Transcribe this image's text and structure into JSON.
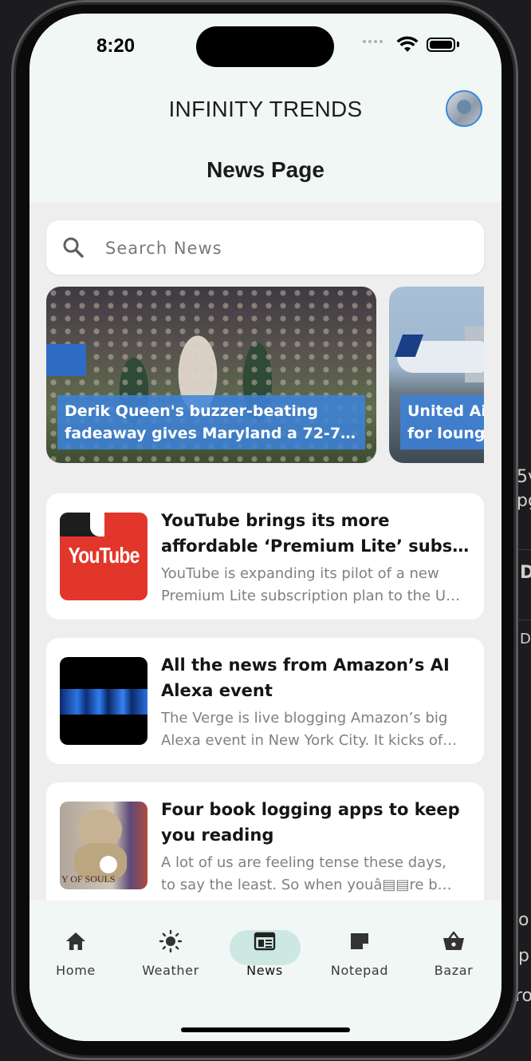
{
  "status_bar": {
    "time": "8:20"
  },
  "header": {
    "app_title": "INFINITY TRENDS",
    "page_title": "News Page"
  },
  "search": {
    "placeholder": "Search News"
  },
  "carousel": [
    {
      "line1": "Derik Queen's buzzer-beating",
      "line2": "fadeaway gives Maryland a 72-71 …"
    },
    {
      "line1": "United Ai",
      "line2": "for lounge"
    }
  ],
  "news": [
    {
      "title_line1": "YouTube brings its more",
      "title_line2": "affordable ‘Premium Lite’ subsc…",
      "desc_line1": "YouTube is expanding its pilot of a new",
      "desc_line2": "Premium Lite subscription plan to the U…",
      "thumb_text": "YouTube"
    },
    {
      "title_line1": "All the news from Amazon’s AI",
      "title_line2": "Alexa event",
      "desc_line1": "The Verge is live blogging Amazon’s big",
      "desc_line2": "Alexa event in New York City. It kicks of…"
    },
    {
      "title_line1": "Four book logging apps to keep",
      "title_line2": "you reading",
      "desc_line1": "A lot of us are feeling tense these days,",
      "desc_line2": "to say the least. So when youâ▤▤re b…",
      "thumb_text": "Y OF SOULS"
    }
  ],
  "bottom_nav": {
    "items": [
      {
        "label": "Home",
        "icon": "home-icon"
      },
      {
        "label": "Weather",
        "icon": "sun-icon"
      },
      {
        "label": "News",
        "icon": "newspaper-icon",
        "active": true
      },
      {
        "label": "Notepad",
        "icon": "note-icon"
      },
      {
        "label": "Bazar",
        "icon": "basket-icon"
      }
    ]
  },
  "background_fragments": [
    "5v",
    "pg",
    "D",
    "D",
    "o",
    "p",
    "ro"
  ],
  "colors": {
    "accent_pill": "#cde8e2",
    "caption_bg": "#3c82dc",
    "header_bg": "#f0f7f5"
  }
}
